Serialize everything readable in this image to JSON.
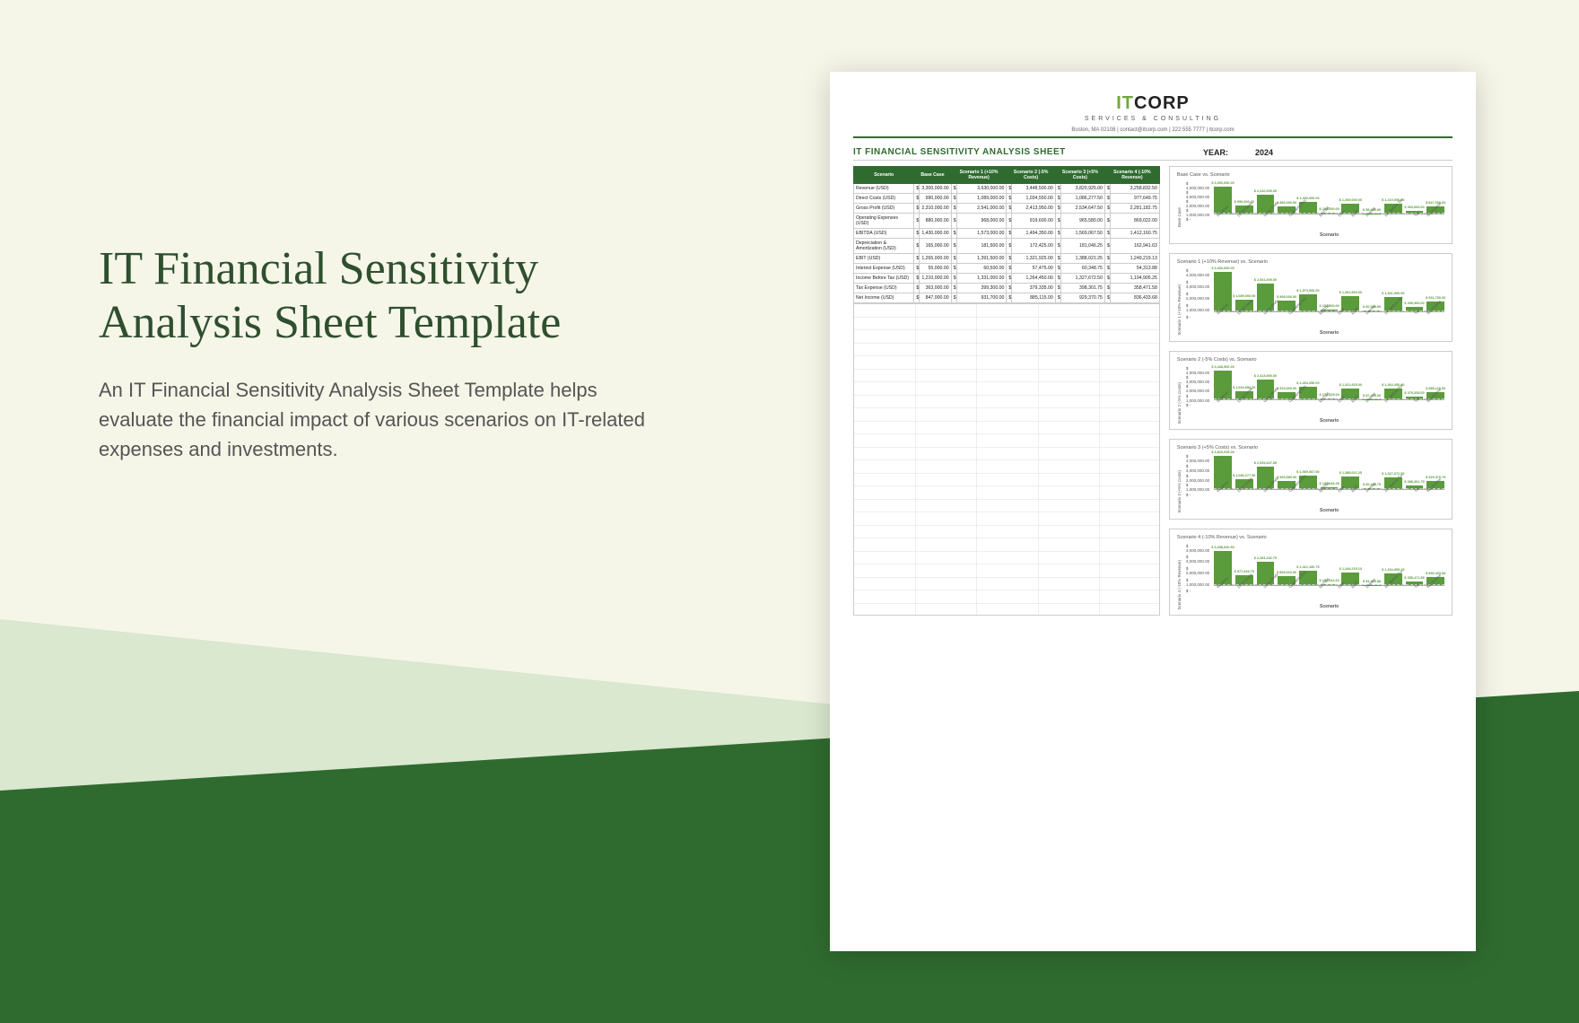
{
  "hero": {
    "title": "IT Financial Sensitivity Analysis Sheet Template",
    "description": "An IT Financial Sensitivity Analysis Sheet Template helps evaluate the financial impact of various scenarios on IT-related expenses and investments."
  },
  "logo": {
    "it": "IT",
    "corp": "CORP",
    "subtitle": "SERVICES & CONSULTING",
    "contact": "Boston, MA 02108   |   contact@itcorp.com   |   222 555 7777   |   itcorp.com"
  },
  "sheet": {
    "title": "IT FINANCIAL SENSITIVITY ANALYSIS SHEET",
    "year_label": "YEAR:",
    "year": "2024",
    "columns": [
      "Scenario",
      "Base Case",
      "Scenario 1 (+10% Revenue)",
      "Scenario 2 (-5% Costs)",
      "Scenario 3 (+5% Costs)",
      "Scenario 4 (-10% Revenue)"
    ],
    "rows": [
      {
        "label": "Revenue (USD)",
        "vals": [
          "3,300,000.00",
          "3,630,000.00",
          "3,448,500.00",
          "3,820,925.00",
          "3,258,832.50"
        ]
      },
      {
        "label": "Direct Costs (USD)",
        "vals": [
          "990,000.00",
          "1,089,000.00",
          "1,034,550.00",
          "1,086,277.50",
          "977,649.75"
        ]
      },
      {
        "label": "Gross Profit (USD)",
        "vals": [
          "2,310,000.00",
          "2,541,000.00",
          "2,413,950.00",
          "2,534,647.50",
          "2,281,182.75"
        ]
      },
      {
        "label": "Operating Expenses (USD)",
        "vals": [
          "880,000.00",
          "968,000.00",
          "919,600.00",
          "965,580.00",
          "869,022.00"
        ]
      },
      {
        "label": "EBITDA (USD)",
        "vals": [
          "1,430,000.00",
          "1,573,000.00",
          "1,494,350.00",
          "1,569,067.50",
          "1,412,160.75"
        ]
      },
      {
        "label": "Depreciation & Amortization (USD)",
        "vals": [
          "165,000.00",
          "181,500.00",
          "172,425.00",
          "181,046.25",
          "162,941.63"
        ]
      },
      {
        "label": "EBIT (USD)",
        "vals": [
          "1,265,000.00",
          "1,391,500.00",
          "1,321,925.00",
          "1,388,021.25",
          "1,249,219.13"
        ]
      },
      {
        "label": "Interest Expense (USD)",
        "vals": [
          "55,000.00",
          "60,500.00",
          "57,475.00",
          "60,348.75",
          "54,313.88"
        ]
      },
      {
        "label": "Income Before Tax (USD)",
        "vals": [
          "1,210,000.00",
          "1,331,000.00",
          "1,264,450.00",
          "1,327,672.50",
          "1,194,905.25"
        ]
      },
      {
        "label": "Tax Expense (USD)",
        "vals": [
          "363,000.00",
          "399,300.00",
          "379,335.00",
          "398,301.75",
          "358,471.58"
        ]
      },
      {
        "label": "Net Income (USD)",
        "vals": [
          "847,000.00",
          "931,700.00",
          "885,115.00",
          "929,370.75",
          "836,433.68"
        ]
      }
    ]
  },
  "chart_data": [
    {
      "type": "bar",
      "title": "Base Case vs. Scenario",
      "ylabel": "Base Case",
      "xlabel": "Scenario",
      "yticks": [
        "$ 4,000,000.00",
        "$ 3,000,000.00",
        "$ 2,000,000.00",
        "$ 1,000,000.00",
        "$ -"
      ],
      "categories": [
        "Revenue",
        "Direct Costs",
        "Gross Profit",
        "Operating Exp.",
        "EBITDA",
        "D&A",
        "EBIT",
        "Interest",
        "Inc. Before Tax",
        "Tax",
        "Net Income"
      ],
      "values": [
        3300000,
        990000,
        2310000,
        880000,
        1430000,
        165000,
        1265000,
        55000,
        1210000,
        363000,
        847000
      ],
      "ylim": [
        0,
        4000000
      ]
    },
    {
      "type": "bar",
      "title": "Scenario 1 (+10% Revenue) vs. Scenario",
      "ylabel": "Scenario 1 (+10% Revenue)",
      "xlabel": "Scenario",
      "yticks": [
        "$ 4,000,000.00",
        "$ 3,000,000.00",
        "$ 2,000,000.00",
        "$ 1,000,000.00",
        "$ -"
      ],
      "categories": [
        "Revenue",
        "Direct Costs",
        "Gross Profit",
        "Operating Exp.",
        "EBITDA",
        "D&A",
        "EBIT",
        "Interest",
        "Inc. Before Tax",
        "Tax",
        "Net Income"
      ],
      "values": [
        3630000,
        1089000,
        2541000,
        968000,
        1573000,
        181500,
        1391500,
        60500,
        1331000,
        399300,
        931700
      ],
      "ylim": [
        0,
        4000000
      ]
    },
    {
      "type": "bar",
      "title": "Scenario 2 (-5% Costs) vs. Scenario",
      "ylabel": "Scenario 2 (-5% Costs)",
      "xlabel": "Scenario",
      "yticks": [
        "$ 4,000,000.00",
        "$ 3,000,000.00",
        "$ 2,000,000.00",
        "$ 1,000,000.00",
        "$ -"
      ],
      "categories": [
        "Revenue",
        "Direct Costs",
        "Gross Profit",
        "Operating Exp.",
        "EBITDA",
        "D&A",
        "EBIT",
        "Interest",
        "Inc. Before Tax",
        "Tax",
        "Net Income"
      ],
      "values": [
        3448500,
        1034550,
        2413950,
        919600,
        1494350,
        172425,
        1321925,
        57475,
        1264450,
        379335,
        885115
      ],
      "ylim": [
        0,
        4000000
      ]
    },
    {
      "type": "bar",
      "title": "Scenario 3 (+5% Costs) vs. Scenario",
      "ylabel": "Scenario 3 (+5% Costs)",
      "xlabel": "Scenario",
      "yticks": [
        "$ 4,000,000.00",
        "$ 3,000,000.00",
        "$ 2,000,000.00",
        "$ 1,000,000.00",
        "$ -"
      ],
      "categories": [
        "Revenue",
        "Direct Costs",
        "Gross Profit",
        "Operating Exp.",
        "EBITDA",
        "D&A",
        "EBIT",
        "Interest",
        "Inc. Before Tax",
        "Tax",
        "Net Income"
      ],
      "values": [
        3820925,
        1086277.5,
        2534647.5,
        965580,
        1569067.5,
        181046.25,
        1388021.25,
        60348.75,
        1327672.5,
        398301.75,
        929370.75
      ],
      "ylim": [
        0,
        4000000
      ]
    },
    {
      "type": "bar",
      "title": "Scenario 4 (-10% Revenue) vs. Scenario",
      "ylabel": "Scenario 4 (-10% Revenue)",
      "xlabel": "Scenario",
      "yticks": [
        "$ 4,000,000.00",
        "$ 3,000,000.00",
        "$ 2,000,000.00",
        "$ 1,000,000.00",
        "$ -"
      ],
      "categories": [
        "Revenue",
        "Direct Costs",
        "Gross Profit",
        "Operating Exp.",
        "EBITDA",
        "D&A",
        "EBIT",
        "Interest",
        "Inc. Before Tax",
        "Tax",
        "Net Income"
      ],
      "values": [
        3258832.5,
        977649.75,
        2281182.75,
        869022,
        1412160.75,
        162941.63,
        1249219.13,
        54313.88,
        1194905.25,
        358471.58,
        836433.68
      ],
      "ylim": [
        0,
        4000000
      ]
    }
  ]
}
